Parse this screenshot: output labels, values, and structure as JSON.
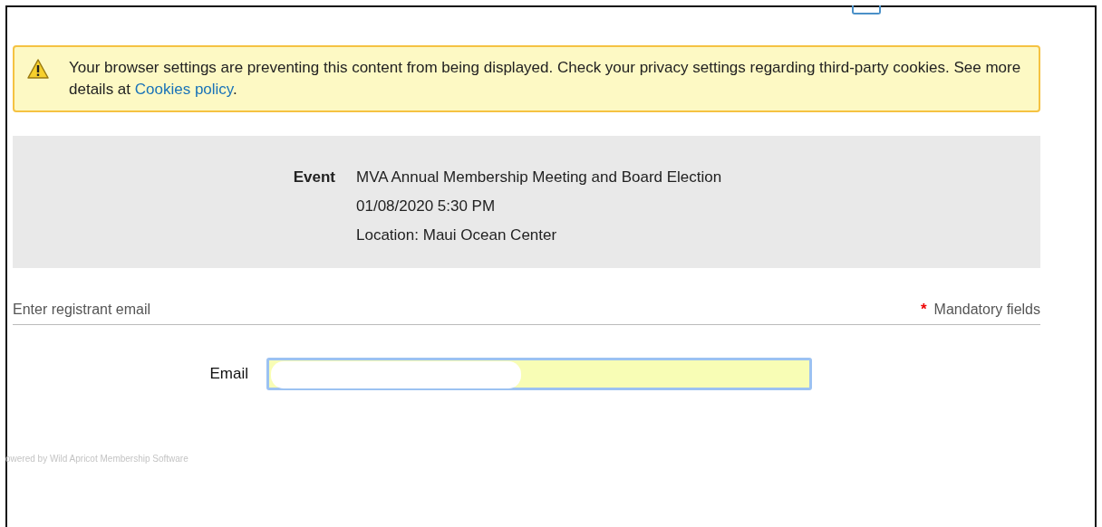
{
  "alert": {
    "text": "Your browser settings are preventing this content from being displayed. Check your privacy settings regarding third-party cookies. See more details at ",
    "link": "Cookies policy",
    "end": "."
  },
  "event": {
    "label": "Event",
    "lines": [
      "MVA Annual Membership Meeting and Board Election",
      "01/08/2020 5:30 PM",
      "Location: Maui Ocean Center"
    ]
  },
  "section": {
    "title": "Enter registrant email",
    "required_mark": "*",
    "required_note": "Mandatory fields"
  },
  "email": {
    "label": "Email",
    "focused": true
  },
  "footer": "owered by Wild Apricot Membership Software"
}
